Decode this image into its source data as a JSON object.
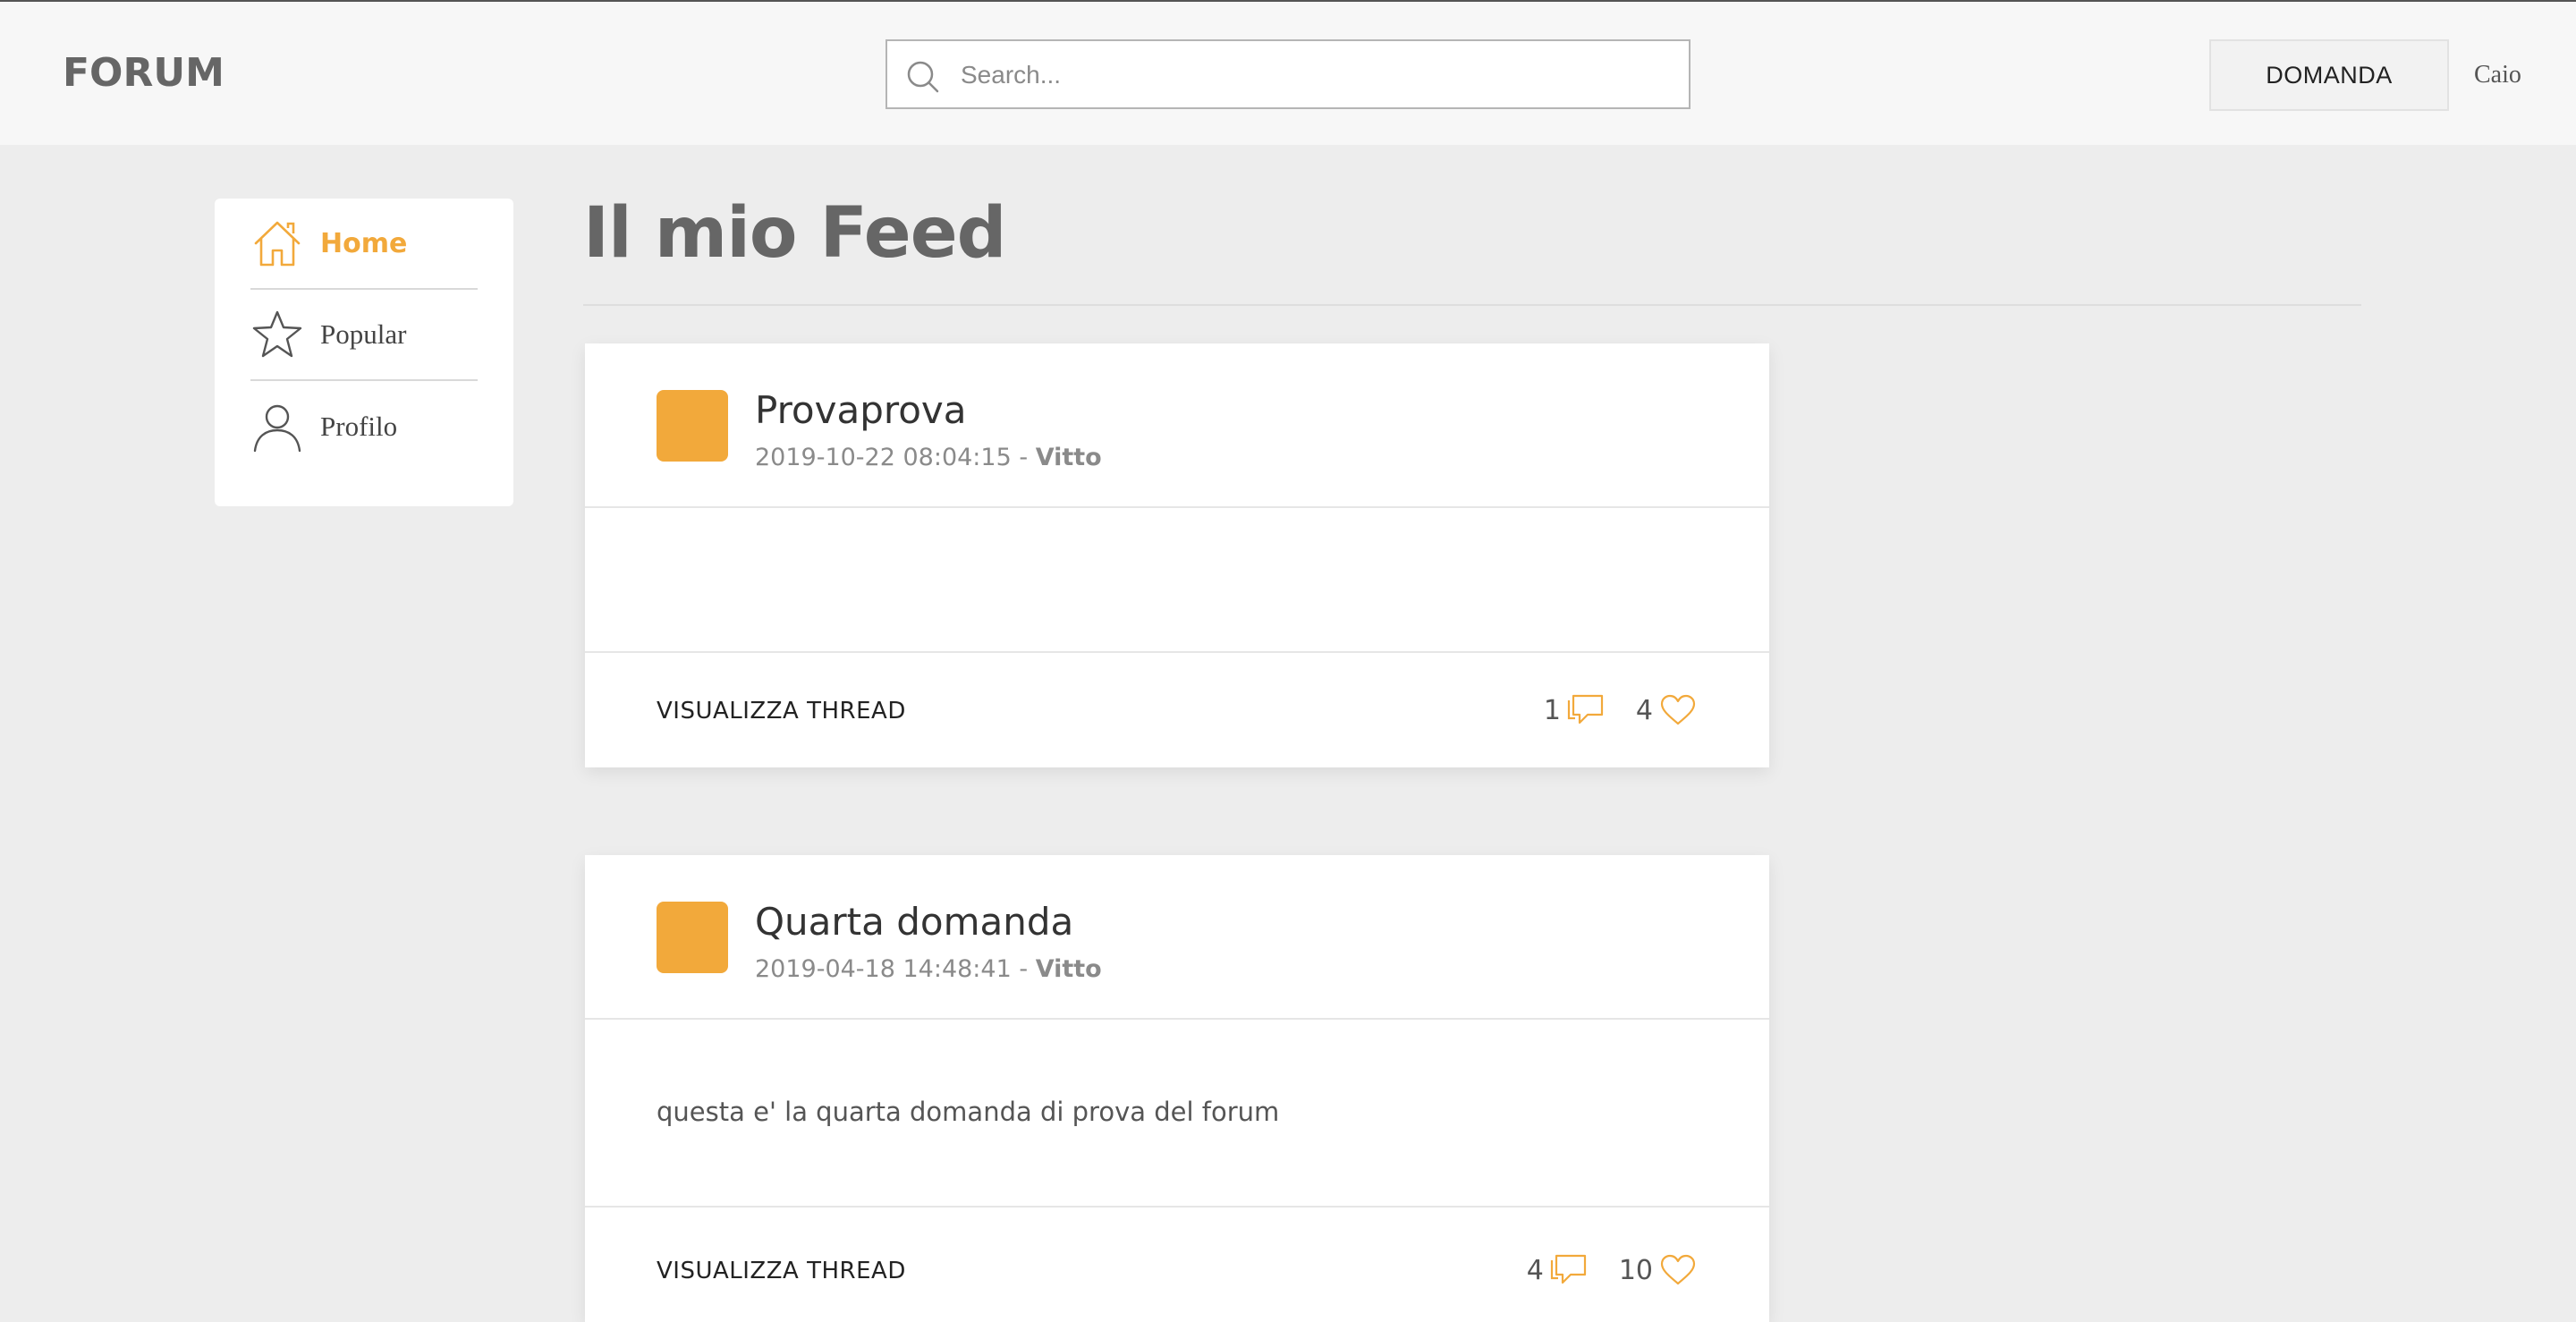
{
  "header": {
    "logo": "FORUM",
    "search_placeholder": "Search...",
    "ask_button": "DOMANDA",
    "username": "Caio"
  },
  "sidebar": {
    "items": [
      {
        "label": "Home",
        "icon": "home-icon",
        "active": true
      },
      {
        "label": "Popular",
        "icon": "star-icon",
        "active": false
      },
      {
        "label": "Profilo",
        "icon": "user-icon",
        "active": false
      }
    ]
  },
  "main": {
    "title": "Il mio Feed",
    "posts": [
      {
        "title": "Provaprova",
        "date": "2019-10-22 08:04:15",
        "separator": " - ",
        "author": "Vitto",
        "body": "",
        "action": "VISUALIZZA THREAD",
        "comments": "1",
        "likes": "4"
      },
      {
        "title": "Quarta domanda",
        "date": "2019-04-18 14:48:41",
        "separator": " - ",
        "author": "Vitto",
        "body": "questa e' la quarta domanda di prova del forum",
        "action": "VISUALIZZA THREAD",
        "comments": "4",
        "likes": "10"
      }
    ]
  },
  "colors": {
    "accent": "#f2a93b",
    "background": "#ededed",
    "header_bg": "#f7f7f7"
  }
}
